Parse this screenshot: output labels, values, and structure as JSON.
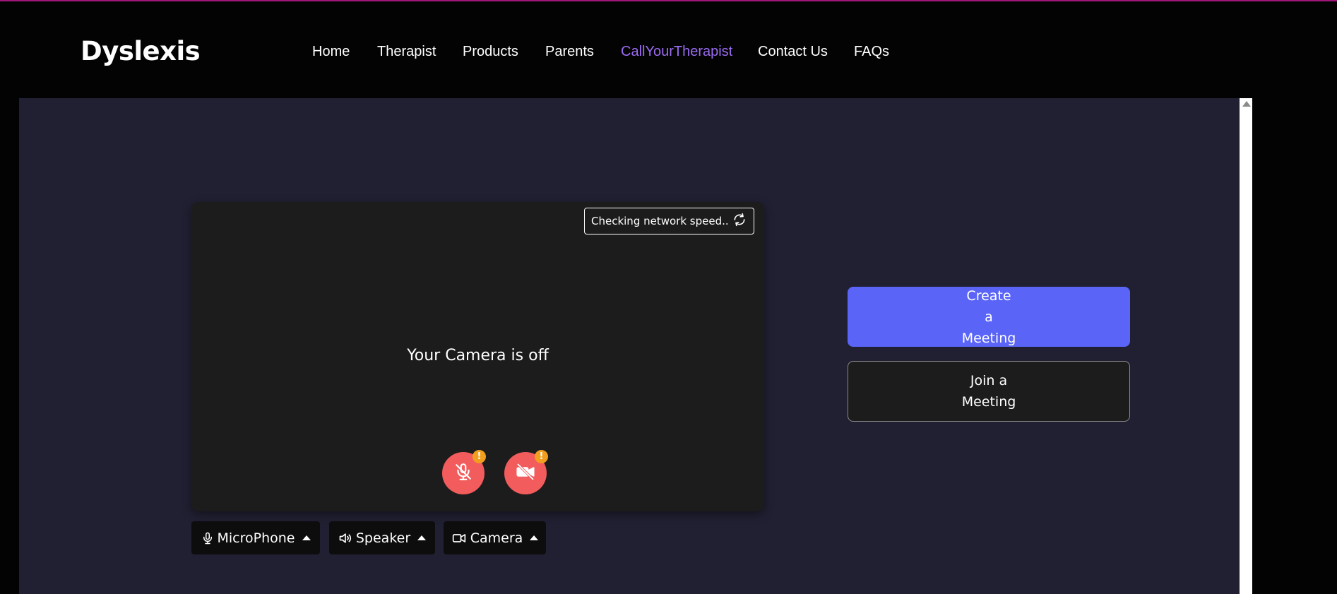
{
  "brand": {
    "name": "Dyslexis"
  },
  "nav": {
    "items": [
      {
        "label": "Home",
        "active": false
      },
      {
        "label": "Therapist",
        "active": false
      },
      {
        "label": "Products",
        "active": false
      },
      {
        "label": "Parents",
        "active": false
      },
      {
        "label": "CallYourTherapist",
        "active": true
      },
      {
        "label": "Contact Us",
        "active": false
      },
      {
        "label": "FAQs",
        "active": false
      }
    ]
  },
  "preview": {
    "network_status": "Checking network speed..",
    "camera_off_message": "Your Camera is off",
    "mic_toggle_icon": "mic-off-icon",
    "camera_toggle_icon": "camera-off-icon",
    "warning_badge": "!"
  },
  "devices": {
    "microphone_label": "MicroPhone",
    "speaker_label": "Speaker",
    "camera_label": "Camera"
  },
  "actions": {
    "create_label": "Create a Meeting",
    "join_label": "Join a Meeting"
  },
  "colors": {
    "accent": "#9b6cf2",
    "primary_button": "#5a65f8",
    "danger": "#f25c5c",
    "warning": "#f29f1f",
    "frame_bg": "#212033"
  }
}
